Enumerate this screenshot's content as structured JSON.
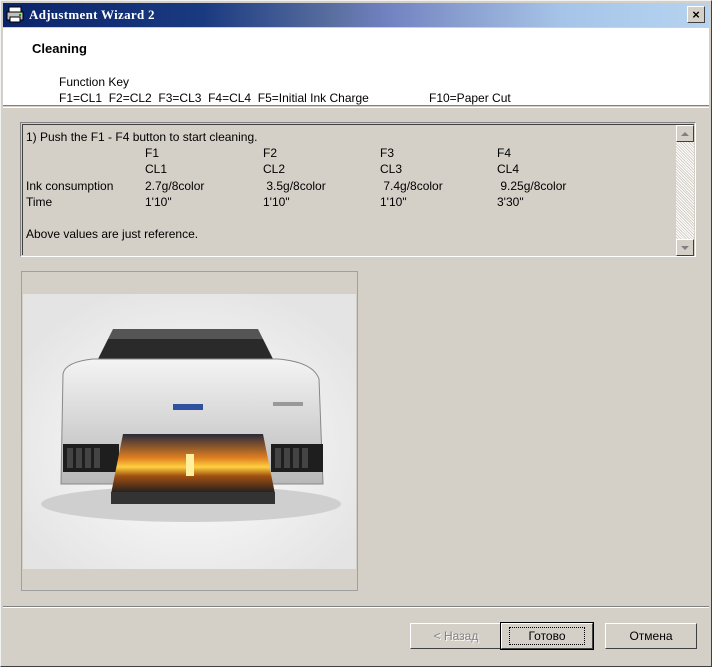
{
  "window": {
    "title": "Adjustment Wizard 2",
    "close_label": "×"
  },
  "header": {
    "page_title": "Cleaning",
    "function_key_title": "Function Key",
    "function_keys": "F1=CL1  F2=CL2  F3=CL3  F4=CL4  F5=Initial Ink Charge",
    "function_keys_extra": "F10=Paper Cut"
  },
  "info": {
    "instruction": "1) Push the F1 - F4 button to start cleaning.",
    "columns": [
      {
        "key": "F1",
        "mode": "CL1",
        "ink": "2.7g/8color",
        "time": "1'10\""
      },
      {
        "key": "F2",
        "mode": "CL2",
        "ink": " 3.5g/8color",
        "time": "1'10\""
      },
      {
        "key": "F3",
        "mode": "CL3",
        "ink": " 7.4g/8color",
        "time": "1'10\""
      },
      {
        "key": "F4",
        "mode": "CL4",
        "ink": " 9.25g/8color",
        "time": "3'30\""
      }
    ],
    "ink_label": "Ink consumption",
    "time_label": "Time",
    "note": "Above values are just reference."
  },
  "buttons": {
    "back": "< Назад",
    "finish": "Готово",
    "cancel": "Отмена"
  },
  "colors": {
    "titlebar_start": "#0a246a",
    "titlebar_end": "#b6d4f0",
    "face": "#d4d0c8"
  }
}
